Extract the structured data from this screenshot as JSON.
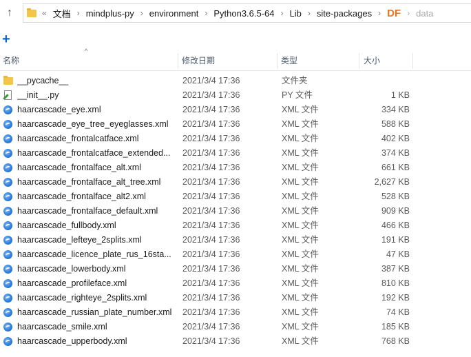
{
  "address": {
    "segments": [
      "文档",
      "mindplus-py",
      "environment",
      "Python3.6.5-64",
      "Lib",
      "site-packages",
      "DF",
      "data"
    ],
    "overflow": "«"
  },
  "toolbar": {
    "new_label": "+"
  },
  "columns": {
    "name": "名称",
    "date": "修改日期",
    "type": "类型",
    "size": "大小"
  },
  "files": [
    {
      "name": "__pycache__",
      "date": "2021/3/4 17:36",
      "type": "文件夹",
      "size": "",
      "icon": "folder-icon"
    },
    {
      "name": "__init__.py",
      "date": "2021/3/4 17:36",
      "type": "PY 文件",
      "size": "1 KB",
      "icon": "python-file-icon"
    },
    {
      "name": "haarcascade_eye.xml",
      "date": "2021/3/4 17:36",
      "type": "XML 文件",
      "size": "334 KB",
      "icon": "xml-file-icon"
    },
    {
      "name": "haarcascade_eye_tree_eyeglasses.xml",
      "date": "2021/3/4 17:36",
      "type": "XML 文件",
      "size": "588 KB",
      "icon": "xml-file-icon"
    },
    {
      "name": "haarcascade_frontalcatface.xml",
      "date": "2021/3/4 17:36",
      "type": "XML 文件",
      "size": "402 KB",
      "icon": "xml-file-icon"
    },
    {
      "name": "haarcascade_frontalcatface_extended...",
      "date": "2021/3/4 17:36",
      "type": "XML 文件",
      "size": "374 KB",
      "icon": "xml-file-icon"
    },
    {
      "name": "haarcascade_frontalface_alt.xml",
      "date": "2021/3/4 17:36",
      "type": "XML 文件",
      "size": "661 KB",
      "icon": "xml-file-icon"
    },
    {
      "name": "haarcascade_frontalface_alt_tree.xml",
      "date": "2021/3/4 17:36",
      "type": "XML 文件",
      "size": "2,627 KB",
      "icon": "xml-file-icon"
    },
    {
      "name": "haarcascade_frontalface_alt2.xml",
      "date": "2021/3/4 17:36",
      "type": "XML 文件",
      "size": "528 KB",
      "icon": "xml-file-icon"
    },
    {
      "name": "haarcascade_frontalface_default.xml",
      "date": "2021/3/4 17:36",
      "type": "XML 文件",
      "size": "909 KB",
      "icon": "xml-file-icon"
    },
    {
      "name": "haarcascade_fullbody.xml",
      "date": "2021/3/4 17:36",
      "type": "XML 文件",
      "size": "466 KB",
      "icon": "xml-file-icon"
    },
    {
      "name": "haarcascade_lefteye_2splits.xml",
      "date": "2021/3/4 17:36",
      "type": "XML 文件",
      "size": "191 KB",
      "icon": "xml-file-icon"
    },
    {
      "name": "haarcascade_licence_plate_rus_16sta...",
      "date": "2021/3/4 17:36",
      "type": "XML 文件",
      "size": "47 KB",
      "icon": "xml-file-icon"
    },
    {
      "name": "haarcascade_lowerbody.xml",
      "date": "2021/3/4 17:36",
      "type": "XML 文件",
      "size": "387 KB",
      "icon": "xml-file-icon"
    },
    {
      "name": "haarcascade_profileface.xml",
      "date": "2021/3/4 17:36",
      "type": "XML 文件",
      "size": "810 KB",
      "icon": "xml-file-icon"
    },
    {
      "name": "haarcascade_righteye_2splits.xml",
      "date": "2021/3/4 17:36",
      "type": "XML 文件",
      "size": "192 KB",
      "icon": "xml-file-icon"
    },
    {
      "name": "haarcascade_russian_plate_number.xml",
      "date": "2021/3/4 17:36",
      "type": "XML 文件",
      "size": "74 KB",
      "icon": "xml-file-icon"
    },
    {
      "name": "haarcascade_smile.xml",
      "date": "2021/3/4 17:36",
      "type": "XML 文件",
      "size": "185 KB",
      "icon": "xml-file-icon"
    },
    {
      "name": "haarcascade_upperbody.xml",
      "date": "2021/3/4 17:36",
      "type": "XML 文件",
      "size": "768 KB",
      "icon": "xml-file-icon"
    }
  ],
  "colors": {
    "accent": "#0a64c8",
    "folder": "#f3c64b",
    "watermark": "#e8751a"
  }
}
